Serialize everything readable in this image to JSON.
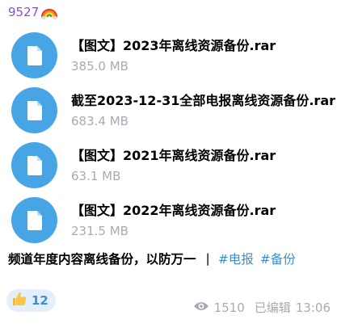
{
  "sender": {
    "name": "9527",
    "emoji_icon": "rainbow-icon"
  },
  "files": [
    {
      "name": "【图文】2023年离线资源备份.rar",
      "size": "385.0 MB",
      "icon": "document-icon"
    },
    {
      "name": "截至2023-12-31全部电报离线资源备份.rar",
      "size": "683.4 MB",
      "icon": "document-icon"
    },
    {
      "name": "【图文】2021年离线资源备份.rar",
      "size": "63.1 MB",
      "icon": "document-icon"
    },
    {
      "name": "【图文】2022年离线资源备份.rar",
      "size": "231.5 MB",
      "icon": "document-icon"
    }
  ],
  "caption": {
    "text": "频道年度内容离线备份，以防万一",
    "separator": "|",
    "tags": [
      "#电报",
      "#备份"
    ]
  },
  "reaction": {
    "emoji": "thumbs-up-icon",
    "count": "12"
  },
  "meta": {
    "views": "1510",
    "edited": "已编辑",
    "time": "13:06"
  },
  "colors": {
    "file_icon_bg": "#47a5e5",
    "sender_name": "#8b4fd0",
    "hashtag": "#3b8fd0",
    "muted": "#a7acb3",
    "reaction_bg": "#e3f0fb"
  }
}
